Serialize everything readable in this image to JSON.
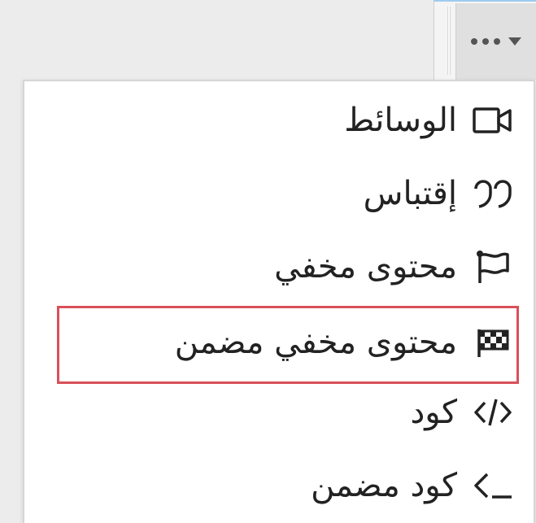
{
  "toolbar": {
    "more_button_icon": "more-dots-with-caret-icon"
  },
  "menu": {
    "items": [
      {
        "label": "الوسائط",
        "icon": "video-camera-icon"
      },
      {
        "label": "إقتباس",
        "icon": "quote-icon"
      },
      {
        "label": "محتوى مخفي",
        "icon": "flag-icon"
      },
      {
        "label": "محتوى مخفي مضمن",
        "icon": "checkered-flag-icon",
        "highlighted": true
      },
      {
        "label": "كود",
        "icon": "code-icon"
      },
      {
        "label": "كود مضمن",
        "icon": "terminal-icon"
      }
    ]
  },
  "colors": {
    "highlight_border": "#d9505a",
    "text": "#222222",
    "menu_background": "#ffffff",
    "page_background": "#ececec"
  }
}
